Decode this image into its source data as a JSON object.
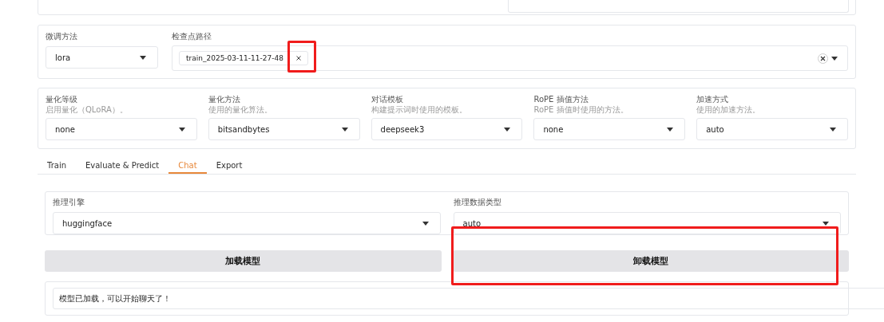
{
  "top_panel": {
    "kind": "path-field"
  },
  "finetune": {
    "method": {
      "label": "微调方法",
      "value": "lora"
    },
    "checkpoint": {
      "label": "检查点路径",
      "tags": [
        "train_2025-03-11-11-27-48"
      ]
    }
  },
  "quantization": [
    {
      "label": "量化等级",
      "hint": "启用量化（QLoRA）。",
      "value": "none"
    },
    {
      "label": "量化方法",
      "hint": "使用的量化算法。",
      "value": "bitsandbytes"
    },
    {
      "label": "对话模板",
      "hint": "构建提示词时使用的模板。",
      "value": "deepseek3"
    },
    {
      "label": "RoPE 插值方法",
      "hint": "RoPE 插值时使用的方法。",
      "value": "none"
    },
    {
      "label": "加速方式",
      "hint": "使用的加速方法。",
      "value": "auto"
    }
  ],
  "tabs": [
    {
      "label": "Train",
      "selected": false
    },
    {
      "label": "Evaluate & Predict",
      "selected": false
    },
    {
      "label": "Chat",
      "selected": true
    },
    {
      "label": "Export",
      "selected": false
    }
  ],
  "chat": {
    "engine": {
      "label": "推理引擎",
      "value": "huggingface"
    },
    "dtype": {
      "label": "推理数据类型",
      "value": "auto"
    },
    "buttons": [
      "加载模型",
      "卸载模型"
    ],
    "info": "模型已加载，可以开始聊天了！"
  }
}
